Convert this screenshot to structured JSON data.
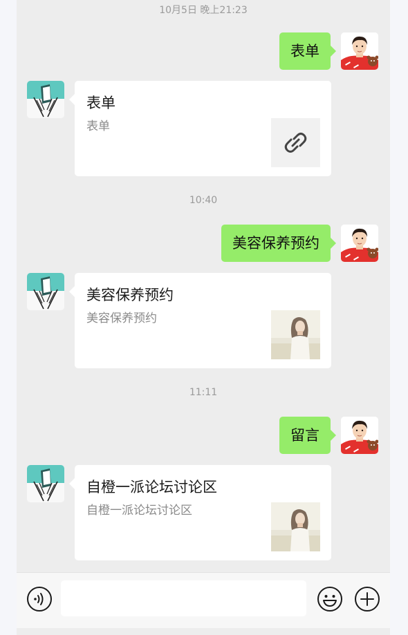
{
  "timestamps": [
    "10月5日 晚上21:23",
    "10:40",
    "11:11"
  ],
  "messages": [
    {
      "sent": "表单",
      "card": {
        "title": "表单",
        "desc": "表单",
        "thumb_icon": "link-icon"
      }
    },
    {
      "sent": "美容保养预约",
      "card": {
        "title": "美容保养预约",
        "desc": "美容保养预约",
        "thumb_icon": "photo-woman-thumbnail"
      }
    },
    {
      "sent": "留言",
      "card": {
        "title": "自橙一派论坛讨论区",
        "desc": "自橙一派论坛讨论区",
        "thumb_icon": "photo-woman-thumbnail"
      }
    }
  ],
  "input_bar": {
    "voice_icon": "voice-icon",
    "input_value": "",
    "emoji_icon": "emoji-icon",
    "add_icon": "plus-icon"
  },
  "colors": {
    "chat_bg": "#ededed",
    "sent_bubble": "#95ec69",
    "card_bg": "#ffffff",
    "timestamp_text": "#9a9a9a"
  }
}
